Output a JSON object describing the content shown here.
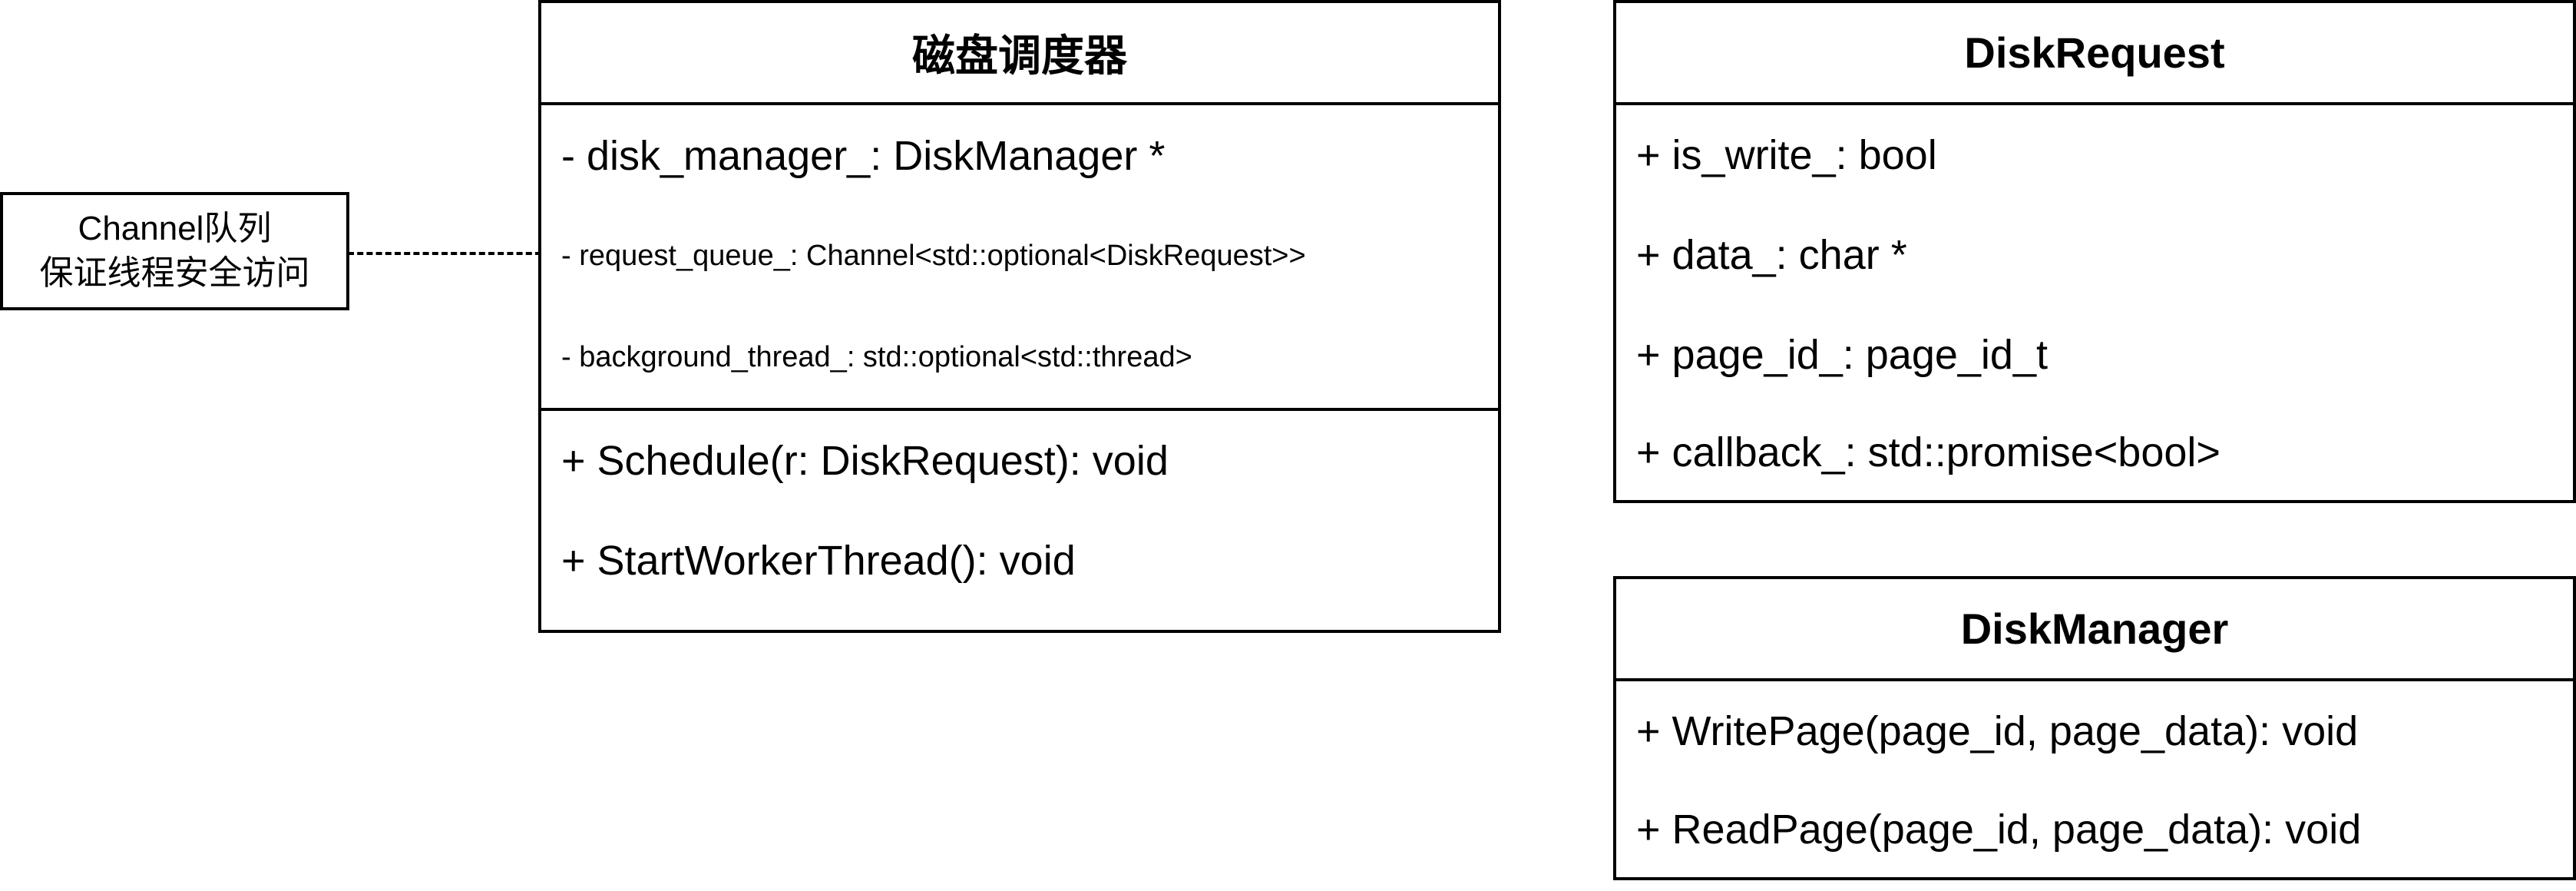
{
  "note": {
    "line1": "Channel队列",
    "line2": "保证线程安全访问"
  },
  "scheduler": {
    "title": "磁盘调度器",
    "fields": [
      "- disk_manager_: DiskManager *",
      "- request_queue_: Channel<std::optional<DiskRequest>>",
      "- background_thread_: std::optional<std::thread>"
    ],
    "methods": [
      "+ Schedule(r: DiskRequest): void",
      "+ StartWorkerThread(): void"
    ]
  },
  "disk_request": {
    "title": "DiskRequest",
    "fields": [
      "+ is_write_: bool",
      "+ data_: char *",
      "+ page_id_: page_id_t",
      "+ callback_: std::promise<bool>"
    ]
  },
  "disk_manager": {
    "title": "DiskManager",
    "methods": [
      "+ WritePage(page_id, page_data): void",
      "+ ReadPage(page_id, page_data): void"
    ]
  }
}
